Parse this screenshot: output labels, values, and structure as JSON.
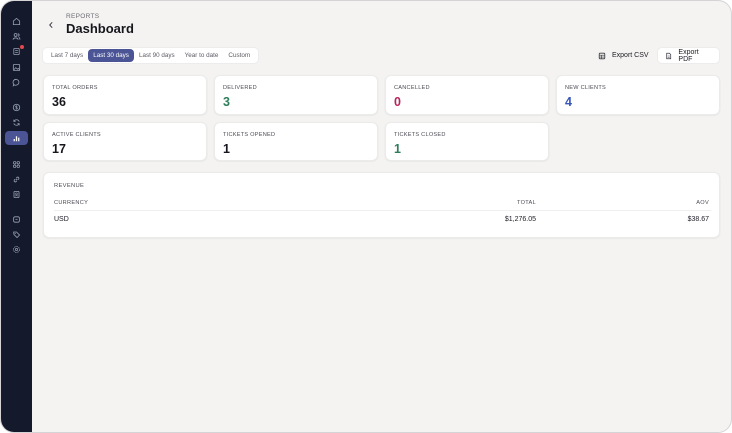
{
  "header": {
    "eyebrow": "REPORTS",
    "title": "Dashboard"
  },
  "sidebar": {
    "items": [
      {
        "icon": "home-icon"
      },
      {
        "icon": "users-icon"
      },
      {
        "icon": "orders-icon",
        "badge": true
      },
      {
        "icon": "images-icon"
      },
      {
        "icon": "chat-icon"
      },
      {
        "icon": "dollar-icon"
      },
      {
        "icon": "refresh-icon"
      },
      {
        "icon": "reports-icon",
        "active": true
      },
      {
        "icon": "grid-icon"
      },
      {
        "icon": "link-icon"
      },
      {
        "icon": "document-icon"
      },
      {
        "icon": "clock-icon"
      },
      {
        "icon": "tag-icon"
      },
      {
        "icon": "settings-icon"
      }
    ]
  },
  "ranges": [
    "Last 7 days",
    "Last 30 days",
    "Last 90 days",
    "Year to date",
    "Custom"
  ],
  "selected_range": "Last 30 days",
  "exports": {
    "csv": "Export CSV",
    "pdf": "Export PDF"
  },
  "stats": [
    {
      "label": "TOTAL ORDERS",
      "value": "36",
      "color": "#16161d"
    },
    {
      "label": "DELIVERED",
      "value": "3",
      "color": "#2e7d5a"
    },
    {
      "label": "CANCELLED",
      "value": "0",
      "color": "#b8245a"
    },
    {
      "label": "NEW CLIENTS",
      "value": "4",
      "color": "#3656b8"
    },
    {
      "label": "ACTIVE CLIENTS",
      "value": "17",
      "color": "#16161d"
    },
    {
      "label": "TICKETS OPENED",
      "value": "1",
      "color": "#16161d"
    },
    {
      "label": "TICKETS CLOSED",
      "value": "1",
      "color": "#2e7d5a"
    }
  ],
  "revenue": {
    "title": "REVENUE",
    "columns": [
      "CURRENCY",
      "TOTAL",
      "AOV"
    ],
    "rows": [
      {
        "currency": "USD",
        "total": "$1,276.05",
        "aov": "$38.67"
      }
    ]
  },
  "colors": {
    "sidebar_bg": "#141a2b",
    "accent": "#4b5494",
    "badge": "#e5484d"
  }
}
